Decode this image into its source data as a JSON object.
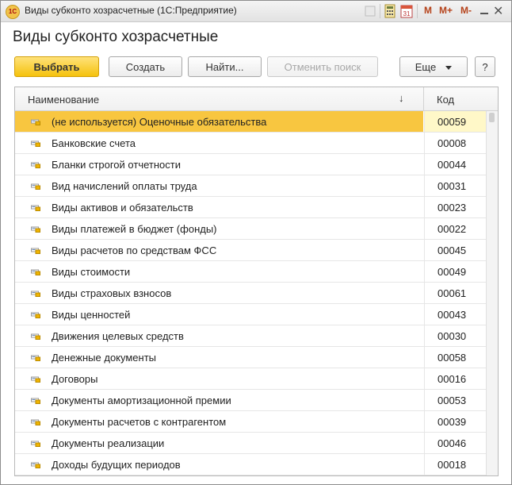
{
  "window": {
    "title": "Виды субконто хозрасчетные  (1С:Предприятие)",
    "app_icon_text": "1С",
    "m_buttons": [
      "M",
      "M+",
      "M-"
    ],
    "close_glyph": "✕"
  },
  "form": {
    "title": "Виды субконто хозрасчетные"
  },
  "toolbar": {
    "select_label": "Выбрать",
    "create_label": "Создать",
    "find_label": "Найти...",
    "cancel_search_label": "Отменить поиск",
    "more_label": "Еще",
    "help_label": "?"
  },
  "table": {
    "columns": {
      "name": "Наименование",
      "sort_indicator": "↓",
      "code": "Код"
    },
    "rows": [
      {
        "name": "(не используется) Оценочные обязательства",
        "code": "00059",
        "selected": true
      },
      {
        "name": "Банковские счета",
        "code": "00008"
      },
      {
        "name": "Бланки строгой отчетности",
        "code": "00044"
      },
      {
        "name": "Вид начислений оплаты труда",
        "code": "00031"
      },
      {
        "name": "Виды активов и обязательств",
        "code": "00023"
      },
      {
        "name": "Виды платежей в бюджет (фонды)",
        "code": "00022"
      },
      {
        "name": "Виды расчетов по средствам ФСС",
        "code": "00045"
      },
      {
        "name": "Виды стоимости",
        "code": "00049"
      },
      {
        "name": "Виды страховых взносов",
        "code": "00061"
      },
      {
        "name": "Виды ценностей",
        "code": "00043"
      },
      {
        "name": "Движения целевых средств",
        "code": "00030"
      },
      {
        "name": "Денежные документы",
        "code": "00058"
      },
      {
        "name": "Договоры",
        "code": "00016"
      },
      {
        "name": "Документы амортизационной премии",
        "code": "00053"
      },
      {
        "name": "Документы расчетов с контрагентом",
        "code": "00039"
      },
      {
        "name": "Документы реализации",
        "code": "00046"
      },
      {
        "name": "Доходы будущих периодов",
        "code": "00018"
      }
    ]
  },
  "colors": {
    "selected_row": "#f8c640",
    "selected_code": "#fff8c8",
    "primary_button": "#f5c20d"
  }
}
